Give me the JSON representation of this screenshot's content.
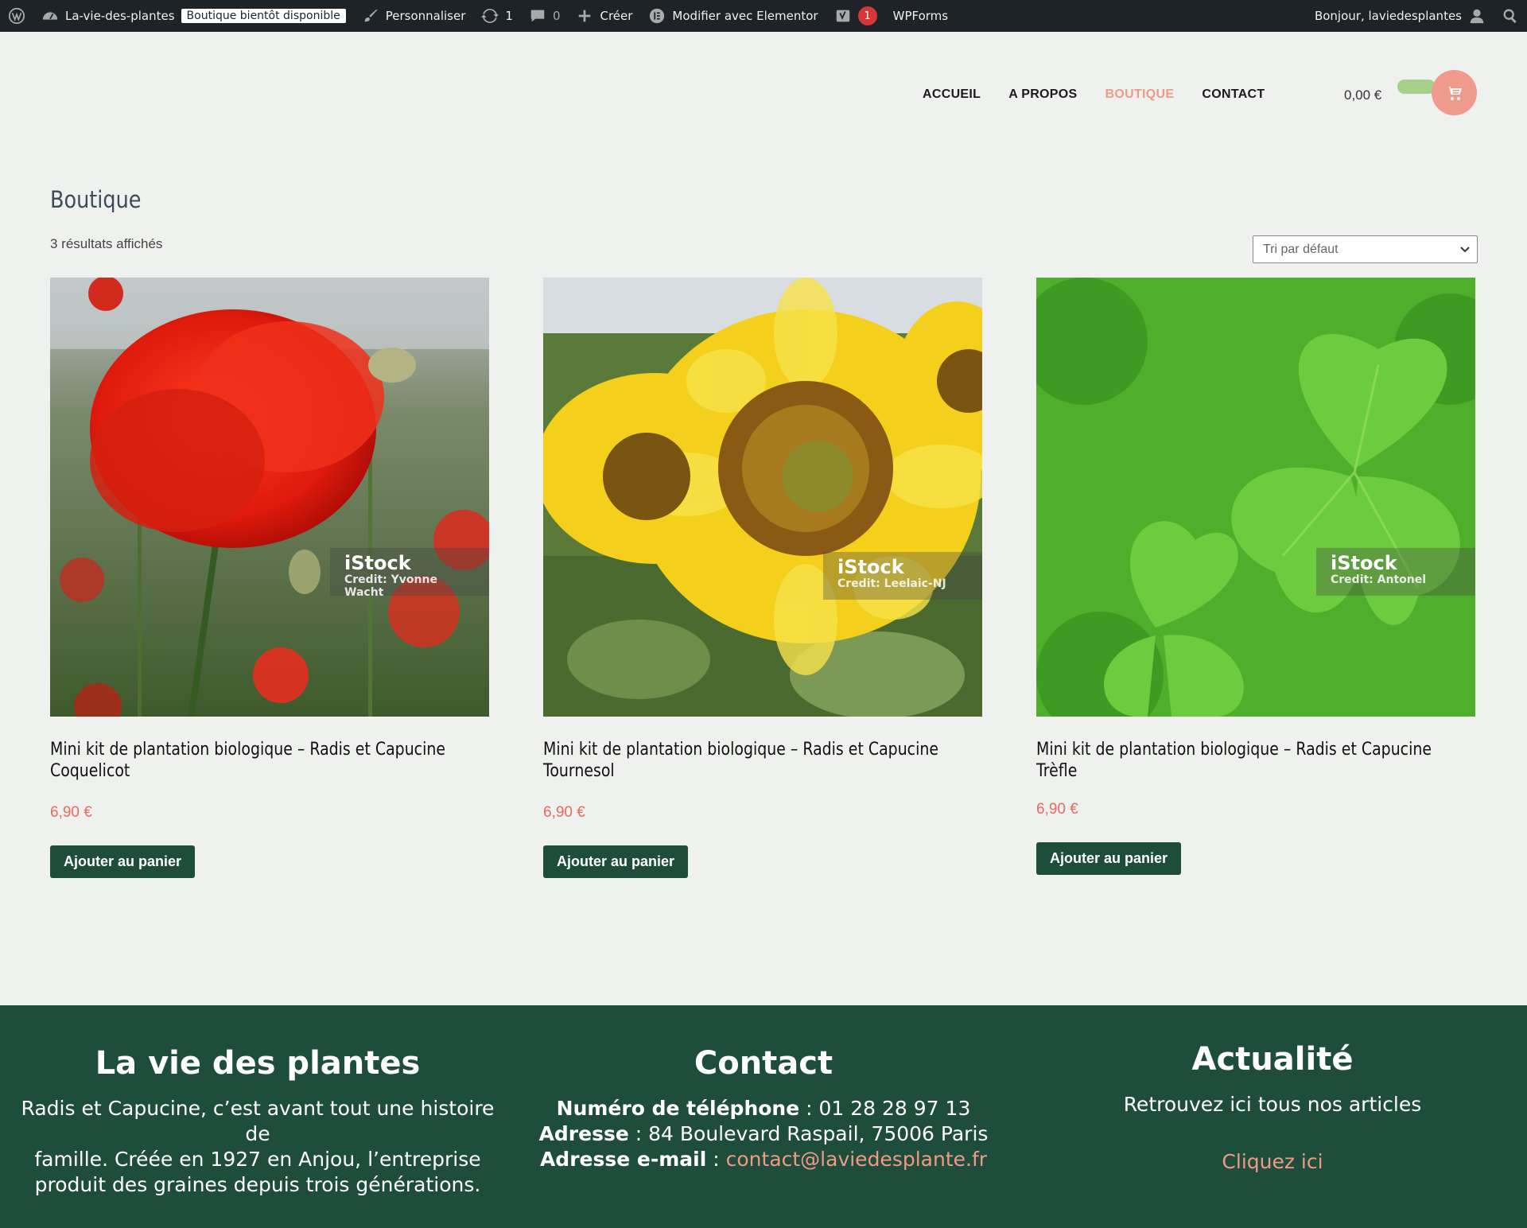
{
  "admin_bar": {
    "site_name": "La-vie-des-plantes",
    "coming_soon_badge": "Boutique bientôt disponible",
    "customize": "Personnaliser",
    "updates_count": "1",
    "comments_count": "0",
    "create": "Créer",
    "elementor": "Modifier avec Elementor",
    "yoast_count": "1",
    "wpforms": "WPForms",
    "greeting": "Bonjour, laviedesplantes"
  },
  "nav": {
    "items": [
      {
        "label": "ACCUEIL"
      },
      {
        "label": "A PROPOS"
      },
      {
        "label": "BOUTIQUE"
      },
      {
        "label": "CONTACT"
      }
    ],
    "active": "BOUTIQUE",
    "active_color": "#ef9a87"
  },
  "cart": {
    "amount": "0,00 €"
  },
  "shop": {
    "title": "Boutique",
    "result_count": "3 résultats affichés",
    "sort_value": "Tri par défaut"
  },
  "products": [
    {
      "title": "Mini kit de plantation biologique – Radis et Capucine Coquelicot",
      "price": "6,90 €",
      "button": "Ajouter au panier",
      "image_brand": "iStock",
      "image_credit": "Credit: Yvonne Wacht"
    },
    {
      "title": "Mini kit de plantation biologique – Radis et Capucine Tournesol",
      "price": "6,90 €",
      "button": "Ajouter au panier",
      "image_brand": "iStock",
      "image_credit": "Credit: Leelaic-NJ"
    },
    {
      "title": "Mini kit de plantation biologique – Radis et Capucine Trèfle",
      "price": "6,90 €",
      "button": "Ajouter au panier",
      "image_brand": "iStock",
      "image_credit": "Credit: Antonel"
    }
  ],
  "footer": {
    "about": {
      "title": "La vie des plantes",
      "line1": "Radis et Capucine, c’est avant tout une histoire",
      "line2": "de",
      "line3": "famille. Créée en 1927 en Anjou, l’entreprise",
      "line4": "produit des graines depuis trois générations."
    },
    "contact": {
      "title": "Contact",
      "phone_label": "Numéro de téléphone",
      "phone_value": " : 01 28 28 97 13",
      "address_label": "Adresse",
      "address_value": " : 84 Boulevard Raspail, 75006 Paris",
      "email_label": "Adresse e-mail",
      "email_sep": " : ",
      "email_value": "contact@laviedesplante.fr"
    },
    "news": {
      "title": "Actualité",
      "text": "Retrouvez ici tous nos articles",
      "link": "Cliquez ici"
    }
  },
  "colors": {
    "footer_bg": "#1f4d3b",
    "button_bg": "#1f4d3b",
    "price": "#e46c60",
    "accent": "#ef9a87",
    "admin_bar_bg": "#1d2327"
  }
}
